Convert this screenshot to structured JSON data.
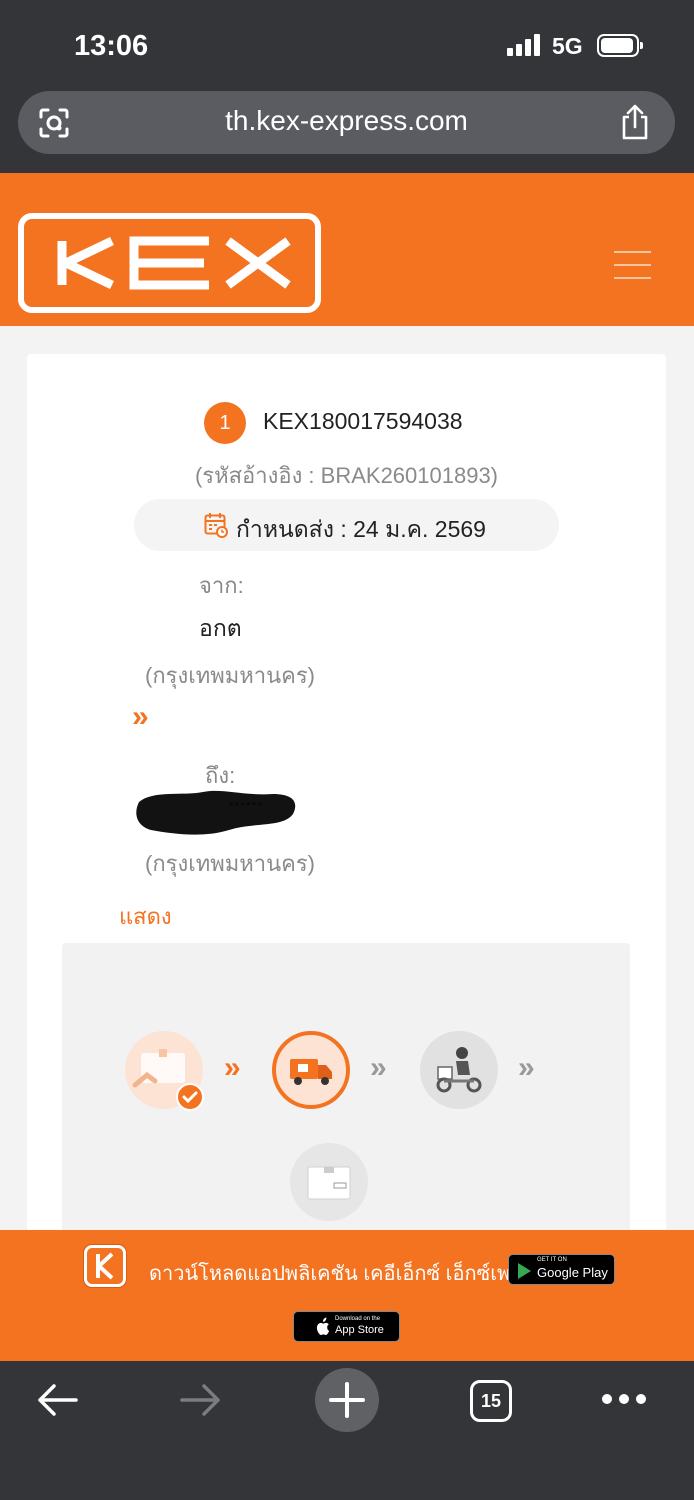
{
  "status_bar": {
    "time": "13:06",
    "network": "5G"
  },
  "browser": {
    "url": "th.kex-express.com",
    "tab_count": "15"
  },
  "site": {
    "logo_text": "KEX",
    "brand_color": "#f37321"
  },
  "shipment": {
    "index": "1",
    "tracking_number": "KEX180017594038",
    "reference": "(รหัสอ้างอิง : BRAK260101893)",
    "due_date": "กำหนดส่ง : 24 ม.ค. 2569",
    "from_label": "จาก:",
    "from_name": "อกต",
    "from_city": "(กรุงเทพมหานคร)",
    "to_label": "ถึง:",
    "to_name": "******",
    "to_city": "(กรุงเทพมหานคร)",
    "show_details": "แสดง"
  },
  "progress": {
    "steps": [
      "picked-up",
      "in-transit",
      "out-for-delivery",
      "delivered"
    ],
    "current_step": 2
  },
  "app_banner": {
    "text": "ดาวน์โหลดแอปพลิเคชัน เคอีเอ็กซ์ เอ็กซ์เพรส",
    "google_play_small": "GET IT ON",
    "google_play_big": "Google Play",
    "app_store_small": "Download on the",
    "app_store_big": "App Store"
  }
}
